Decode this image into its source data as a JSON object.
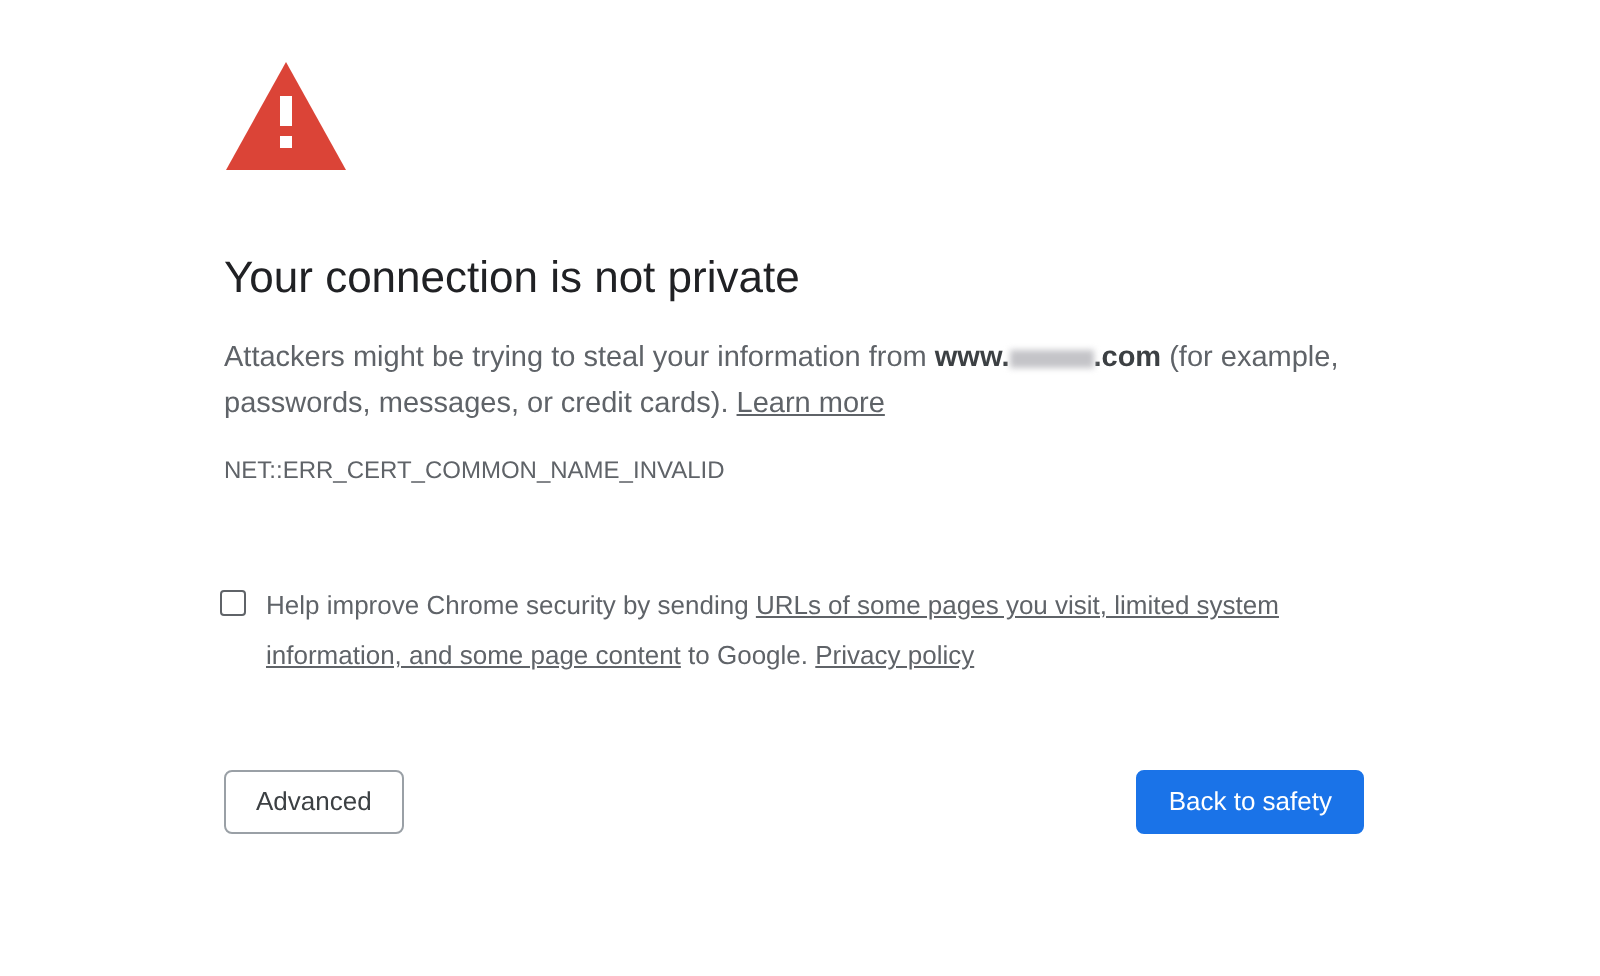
{
  "heading": "Your connection is not private",
  "message": {
    "before": "Attackers might be trying to steal your information from ",
    "domain_start": "www.",
    "domain_end": ".com",
    "after": " (for example, passwords, messages, or credit cards). ",
    "link": "Learn more"
  },
  "error_code": "NET::ERR_CERT_COMMON_NAME_INVALID",
  "opt_in": {
    "checked": false,
    "before": "Help improve Chrome security by sending ",
    "link_lines": [
      "URLs of some pages you visit, limited system",
      "information, and some page content"
    ],
    "middle": " to Google. ",
    "policy_link": "Privacy policy"
  },
  "buttons": [
    {
      "label": "Advanced",
      "kind": "secondary"
    },
    {
      "label": "Back to safety",
      "kind": "primary"
    }
  ]
}
